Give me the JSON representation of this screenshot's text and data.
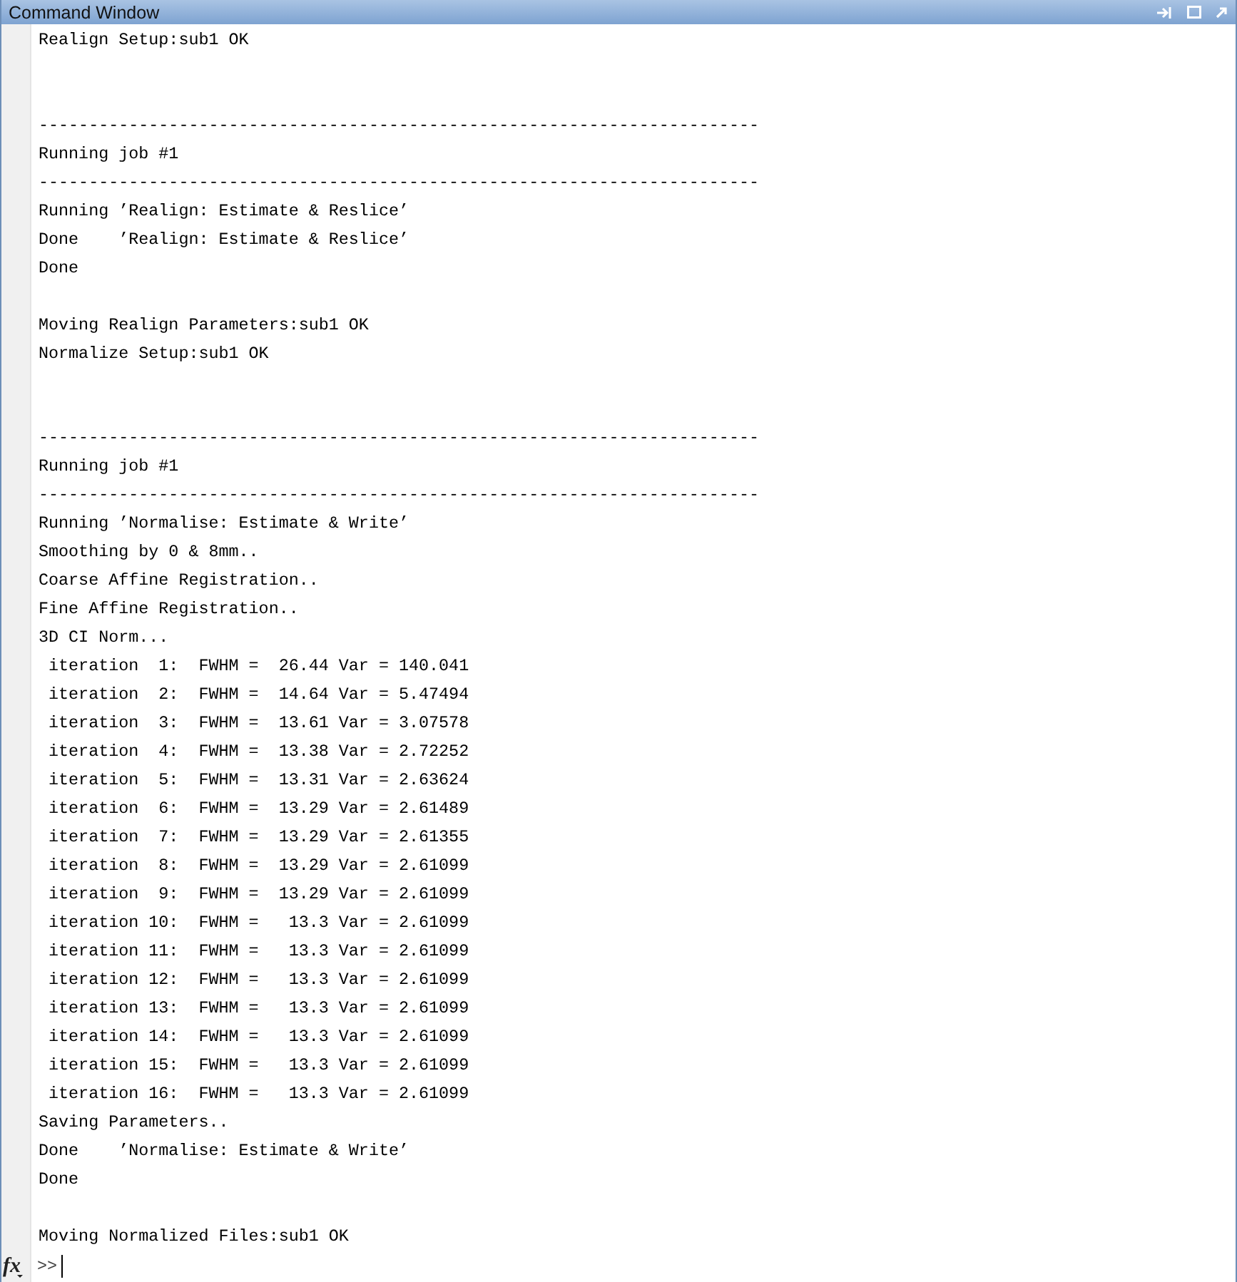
{
  "window": {
    "title": "Command Window"
  },
  "lines": [
    {
      "kind": "text",
      "text": "Realign Setup:sub1 OK"
    },
    {
      "kind": "blank"
    },
    {
      "kind": "blank"
    },
    {
      "kind": "text",
      "text": "------------------------------------------------------------------------"
    },
    {
      "kind": "text",
      "text": "Running job #1"
    },
    {
      "kind": "text",
      "text": "------------------------------------------------------------------------"
    },
    {
      "kind": "text",
      "text": "Running ’Realign: Estimate & Reslice’"
    },
    {
      "kind": "text",
      "text": "Done    ’Realign: Estimate & Reslice’"
    },
    {
      "kind": "text",
      "text": "Done"
    },
    {
      "kind": "blank"
    },
    {
      "kind": "text",
      "text": "Moving Realign Parameters:sub1 OK"
    },
    {
      "kind": "text",
      "text": "Normalize Setup:sub1 OK"
    },
    {
      "kind": "blank"
    },
    {
      "kind": "blank"
    },
    {
      "kind": "text",
      "text": "------------------------------------------------------------------------"
    },
    {
      "kind": "text",
      "text": "Running job #1"
    },
    {
      "kind": "text",
      "text": "------------------------------------------------------------------------"
    },
    {
      "kind": "text",
      "text": "Running ’Normalise: Estimate & Write’"
    },
    {
      "kind": "text",
      "text": "Smoothing by 0 & 8mm.."
    },
    {
      "kind": "text",
      "text": "Coarse Affine Registration.."
    },
    {
      "kind": "text",
      "text": "Fine Affine Registration.."
    },
    {
      "kind": "text",
      "text": "3D CI Norm..."
    },
    {
      "kind": "text",
      "text": " iteration  1:  FWHM =  26.44 Var = 140.041"
    },
    {
      "kind": "text",
      "text": " iteration  2:  FWHM =  14.64 Var = 5.47494"
    },
    {
      "kind": "text",
      "text": " iteration  3:  FWHM =  13.61 Var = 3.07578"
    },
    {
      "kind": "text",
      "text": " iteration  4:  FWHM =  13.38 Var = 2.72252"
    },
    {
      "kind": "text",
      "text": " iteration  5:  FWHM =  13.31 Var = 2.63624"
    },
    {
      "kind": "text",
      "text": " iteration  6:  FWHM =  13.29 Var = 2.61489"
    },
    {
      "kind": "text",
      "text": " iteration  7:  FWHM =  13.29 Var = 2.61355"
    },
    {
      "kind": "text",
      "text": " iteration  8:  FWHM =  13.29 Var = 2.61099"
    },
    {
      "kind": "text",
      "text": " iteration  9:  FWHM =  13.29 Var = 2.61099"
    },
    {
      "kind": "text",
      "text": " iteration 10:  FWHM =   13.3 Var = 2.61099"
    },
    {
      "kind": "text",
      "text": " iteration 11:  FWHM =   13.3 Var = 2.61099"
    },
    {
      "kind": "text",
      "text": " iteration 12:  FWHM =   13.3 Var = 2.61099"
    },
    {
      "kind": "text",
      "text": " iteration 13:  FWHM =   13.3 Var = 2.61099"
    },
    {
      "kind": "text",
      "text": " iteration 14:  FWHM =   13.3 Var = 2.61099"
    },
    {
      "kind": "text",
      "text": " iteration 15:  FWHM =   13.3 Var = 2.61099"
    },
    {
      "kind": "text",
      "text": " iteration 16:  FWHM =   13.3 Var = 2.61099"
    },
    {
      "kind": "text",
      "text": "Saving Parameters.."
    },
    {
      "kind": "text",
      "text": "Done    ’Normalise: Estimate & Write’"
    },
    {
      "kind": "text",
      "text": "Done"
    },
    {
      "kind": "blank"
    },
    {
      "kind": "text",
      "text": "Moving Normalized Files:sub1 OK"
    }
  ],
  "prompt": {
    "icon_text": "fx",
    "symbol": ">>"
  }
}
